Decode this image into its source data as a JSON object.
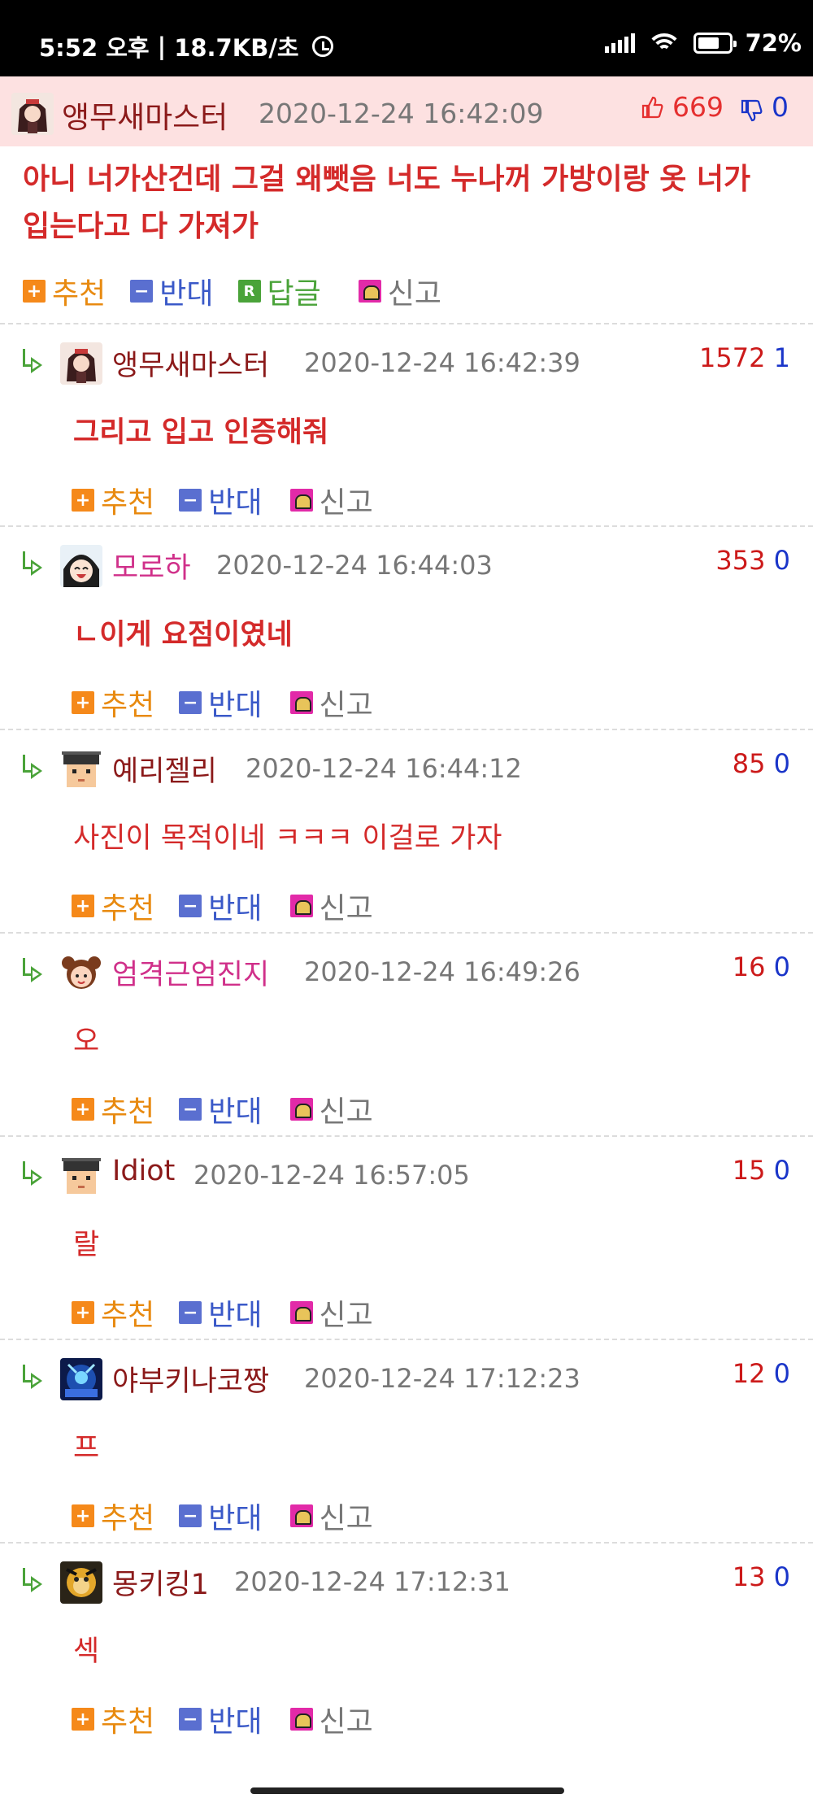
{
  "status_bar": {
    "time": "5:52 오후",
    "speed": "18.7KB/초",
    "battery": "72%",
    "battery_level": 0.72,
    "icons": [
      "alarm-icon",
      "signal-icon",
      "wifi-icon",
      "battery-icon"
    ]
  },
  "colors": {
    "main_header_bg": "#fde1e1",
    "comment_text": "#d42a2a",
    "nick_default": "#8b1a1a",
    "nick_pink": "#d0308a",
    "vote_up": "#cc1a1a",
    "vote_down": "#1a35c9"
  },
  "main_post": {
    "nickname": "앵무새마스터",
    "date": "2020-12-24 16:42:09",
    "upvotes": "669",
    "downvotes": "0",
    "text_line1": "아니 너가산건데 그걸 왜뺏음 너도 누나꺼 가방이랑 옷 너가",
    "text_line2": "입는다고 다 가져가",
    "actions": {
      "recommend": "추천",
      "oppose": "반대",
      "reply": "답글",
      "report": "신고"
    }
  },
  "comment_actions": {
    "recommend": "추천",
    "oppose": "반대",
    "report": "신고"
  },
  "comments": [
    {
      "nickname": "앵무새마스터",
      "date": "2020-12-24 16:42:39",
      "up": "1572",
      "down": "1",
      "text": "그리고 입고 인증해줘",
      "bold": true,
      "nick_color": "default",
      "avatar": "avatar-anime-girl-icon"
    },
    {
      "nickname": "모로하",
      "date": "2020-12-24 16:44:03",
      "up": "353",
      "down": "0",
      "text": "ㄴ이게 요점이였네",
      "bold": true,
      "nick_color": "pink",
      "avatar": "avatar-laughing-girl-icon"
    },
    {
      "nickname": "예리젤리",
      "date": "2020-12-24 16:44:12",
      "up": "85",
      "down": "0",
      "text": "사진이 목적이네 ㅋㅋㅋ 이걸로 가자",
      "bold": false,
      "nick_color": "default",
      "avatar": "avatar-pixel-face-icon"
    },
    {
      "nickname": "엄격근엄진지",
      "date": "2020-12-24 16:49:26",
      "up": "16",
      "down": "0",
      "text": "오",
      "bold": false,
      "nick_color": "pink",
      "avatar": "avatar-cartoon-girl-icon"
    },
    {
      "nickname": "Idiot",
      "date": "2020-12-24 16:57:05",
      "up": "15",
      "down": "0",
      "text": "랄",
      "bold": false,
      "nick_color": "default",
      "avatar": "avatar-pixel-face-icon"
    },
    {
      "nickname": "야부키나코짱",
      "date": "2020-12-24 17:12:23",
      "up": "12",
      "down": "0",
      "text": "프",
      "bold": false,
      "nick_color": "default",
      "avatar": "avatar-robot-icon"
    },
    {
      "nickname": "몽키킹1",
      "date": "2020-12-24 17:12:31",
      "up": "13",
      "down": "0",
      "text": "섹",
      "bold": false,
      "nick_color": "default",
      "avatar": "avatar-monkey-icon"
    }
  ]
}
